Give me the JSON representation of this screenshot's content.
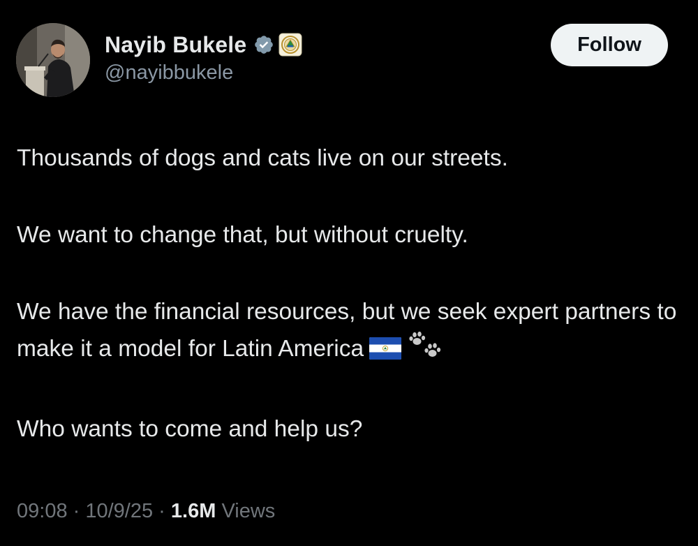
{
  "header": {
    "display_name": "Nayib Bukele",
    "handle": "@nayibbukele",
    "follow_label": "Follow",
    "verified_icon": "verified-check-icon",
    "affiliation_icon": "el-salvador-government-seal-icon",
    "avatar": "avatar-photo"
  },
  "tweet": {
    "paragraphs": [
      "Thousands of dogs and cats live on our streets.",
      "We want to change that, but without cruelty.",
      "We have the financial resources, but we seek expert partners to make it a model for Latin America",
      "Who wants to come and help us?"
    ],
    "emojis": [
      "el-salvador-flag-icon",
      "paw-prints-icon"
    ]
  },
  "meta": {
    "time": "09:08",
    "separator": " · ",
    "date": "10/9/25",
    "views_count": "1.6M",
    "views_label": " Views"
  },
  "colors": {
    "background": "#000000",
    "primary_text": "#e7e9ea",
    "secondary_text": "#71767b",
    "verified_blue": "#829aab",
    "follow_bg": "#eff3f4"
  }
}
